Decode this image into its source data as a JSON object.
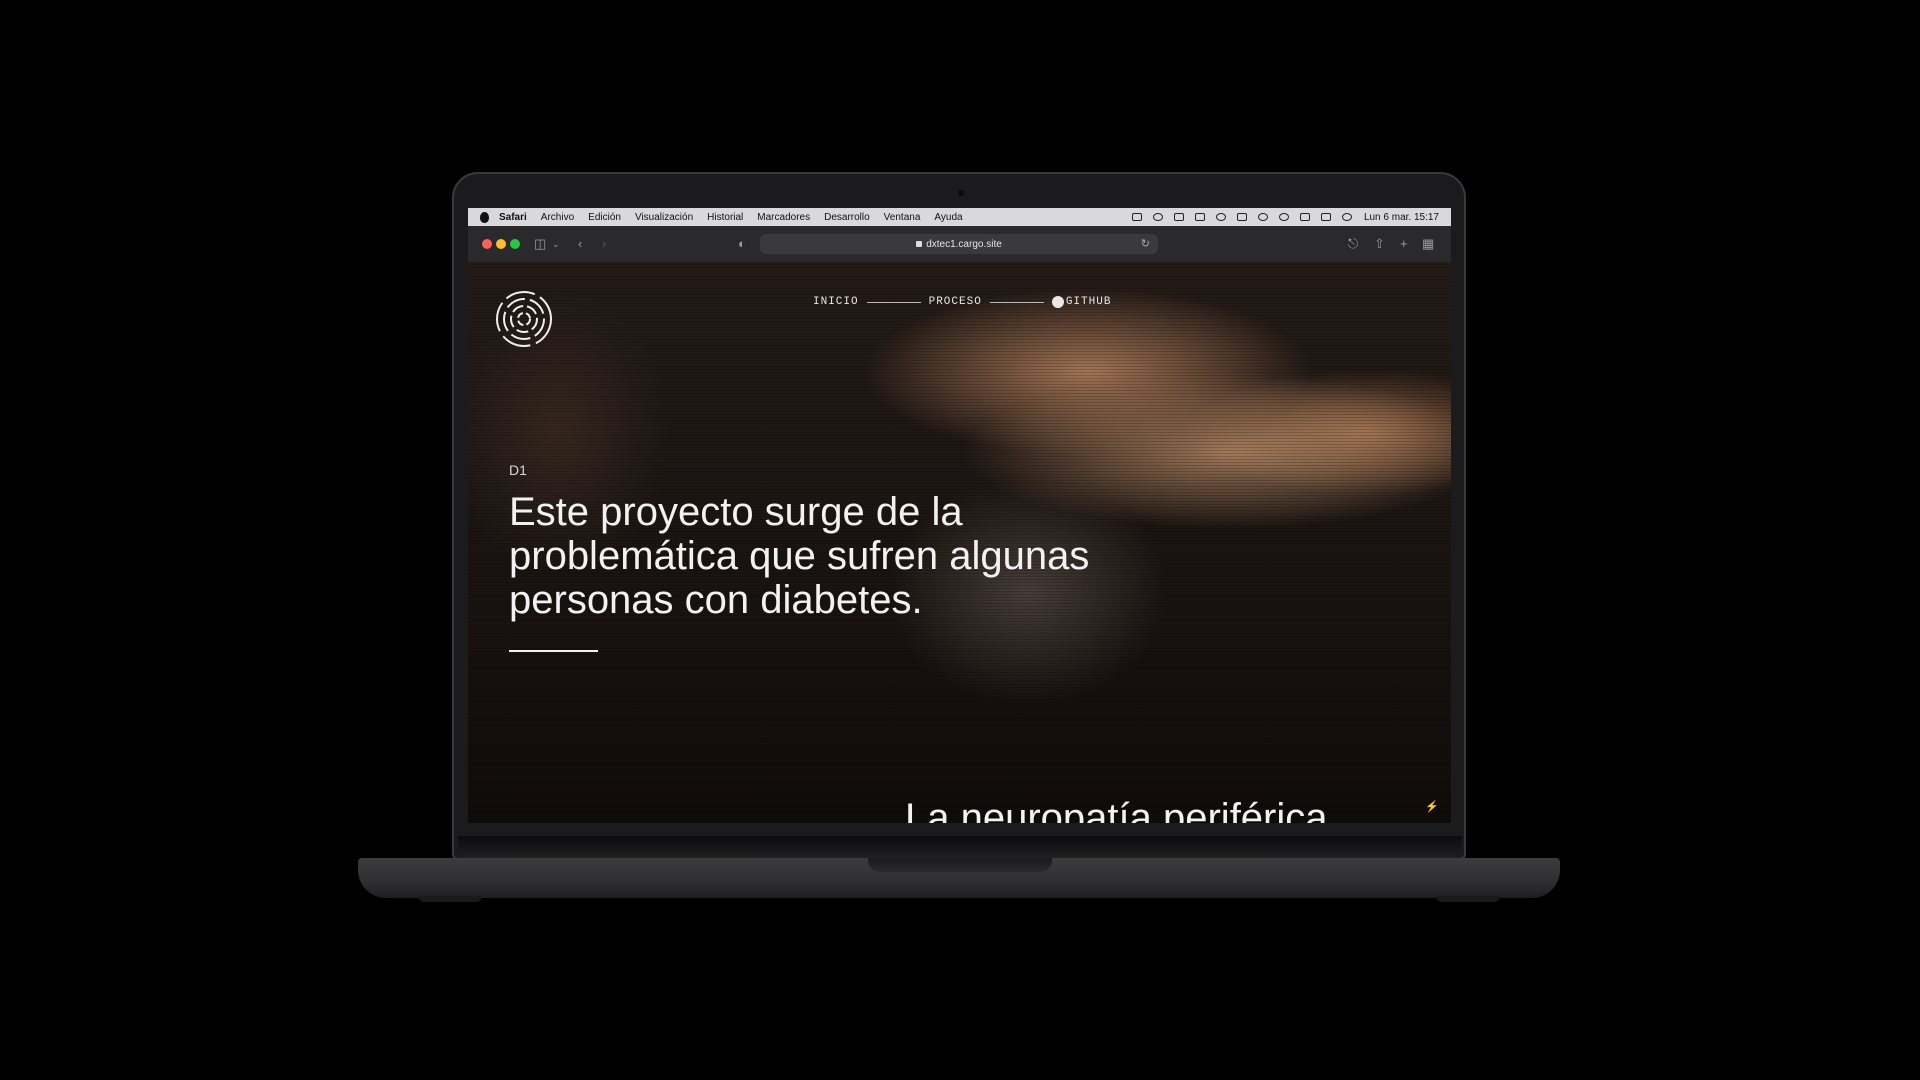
{
  "menubar": {
    "app": "Safari",
    "items": [
      "Archivo",
      "Edición",
      "Visualización",
      "Historial",
      "Marcadores",
      "Desarrollo",
      "Ventana",
      "Ayuda"
    ],
    "clock": "Lun 6 mar.  15:17"
  },
  "browser": {
    "url": "dxtec1.cargo.site"
  },
  "site": {
    "nav": [
      "INICIO",
      "PROCESO",
      "GITHUB"
    ],
    "section_label": "D1",
    "headline": "Este proyecto surge de la problemática que sufren algunas personas con diabetes.",
    "next_heading": "La neuropatía periférica"
  },
  "icons": {
    "menu": "apple-logo-icon",
    "sidebar": "sidebar-toggle-icon",
    "back": "chevron-left-icon",
    "forward": "chevron-right-icon",
    "shield": "privacy-shield-icon",
    "reload": "reload-icon",
    "download": "download-icon",
    "share": "share-icon",
    "newtab": "plus-icon",
    "tabs": "tab-overview-icon",
    "github": "github-icon",
    "bolt": "lightning-icon"
  }
}
